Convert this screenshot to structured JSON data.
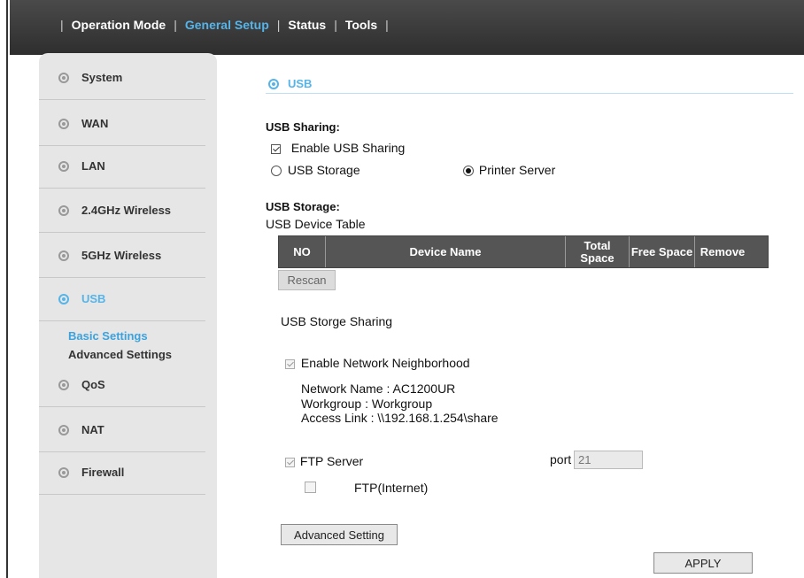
{
  "topnav": {
    "items": [
      {
        "label": "Operation Mode",
        "active": false
      },
      {
        "label": "General Setup",
        "active": true
      },
      {
        "label": "Status",
        "active": false
      },
      {
        "label": "Tools",
        "active": false
      }
    ]
  },
  "sidebar": {
    "items": [
      {
        "label": "System"
      },
      {
        "label": "WAN"
      },
      {
        "label": "LAN"
      },
      {
        "label": "2.4GHz Wireless"
      },
      {
        "label": "5GHz Wireless"
      },
      {
        "label": "USB"
      },
      {
        "label": "QoS"
      },
      {
        "label": "NAT"
      },
      {
        "label": "Firewall"
      }
    ],
    "sub_items": [
      {
        "label": "Basic Settings"
      },
      {
        "label": "Advanced Settings"
      }
    ]
  },
  "main": {
    "section_title": "USB",
    "usb_sharing_heading": "USB Sharing:",
    "enable_usb_sharing": {
      "label": "Enable USB Sharing",
      "checked": true
    },
    "usb_storage_radio": "USB Storage",
    "printer_server_radio": "Printer Server",
    "usb_storage_heading": "USB Storage:",
    "device_table_label": "USB Device Table",
    "table_headers": [
      "NO",
      "Device Name",
      "Total Space",
      "Free Space",
      "Remove"
    ],
    "rescan_button": "Rescan",
    "storage_sharing_label": "USB Storge Sharing",
    "enable_network_neighborhood": "Enable Network Neighborhood",
    "network_name": "Network Name  :  AC1200UR",
    "workgroup": "Workgroup  :  Workgroup",
    "access_link": "Access Link :  \\\\192.168.1.254\\share",
    "ftp_server": "FTP Server",
    "port_label": "port",
    "port_value": "21",
    "ftp_internet": "FTP(Internet)",
    "advanced_setting_button": "Advanced Setting",
    "apply_button": "APPLY"
  },
  "colors": {
    "accent": "#56b4e8",
    "topbar": "#3a3a3a",
    "sidebar": "#e6e6e6",
    "table_header": "#555555"
  }
}
